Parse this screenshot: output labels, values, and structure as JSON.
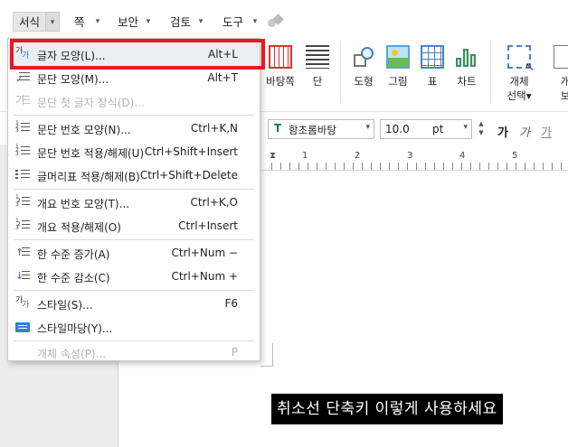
{
  "menubar": {
    "items": [
      {
        "label": "서식",
        "active": true
      },
      {
        "label": "쪽"
      },
      {
        "label": "보안"
      },
      {
        "label": "검토"
      },
      {
        "label": "도구"
      }
    ],
    "dropdown_arrow": "▾"
  },
  "ribbon": {
    "buttons": [
      {
        "label": "바탕쪽",
        "icon": "page-template-icon"
      },
      {
        "label": "단",
        "icon": "columns-icon"
      },
      {
        "label": "도형",
        "icon": "shapes-icon"
      },
      {
        "label": "그림",
        "icon": "picture-icon"
      },
      {
        "label": "표",
        "icon": "table-icon"
      },
      {
        "label": "차트",
        "icon": "chart-icon"
      },
      {
        "label": "개체",
        "sub": "선택",
        "icon": "object-select-icon"
      },
      {
        "label": "개",
        "sub": "보",
        "icon": "object-icon"
      }
    ]
  },
  "format_toolbar": {
    "font_name": "함초롬바탕",
    "font_size": "10.0",
    "size_unit": "pt",
    "style_buttons": [
      "가",
      "가",
      "가"
    ]
  },
  "ruler": {
    "numbers": [
      "1",
      "2",
      "3",
      "4",
      "5"
    ]
  },
  "dropdown": {
    "items": [
      {
        "label": "글자 모양(L)...",
        "shortcut": "Alt+L",
        "icon": "char-shape-icon",
        "disabled": false,
        "highlight": true
      },
      {
        "label": "문단 모양(M)...",
        "shortcut": "Alt+T",
        "icon": "paragraph-shape-icon",
        "disabled": false
      },
      {
        "label": "문단 첫 글자 장식(D)...",
        "shortcut": "",
        "icon": "drop-cap-icon",
        "disabled": true
      },
      {
        "label": "문단 번호 모양(N)...",
        "shortcut": "Ctrl+K,N",
        "icon": "numbering-shape-icon",
        "disabled": false,
        "sep_before": true
      },
      {
        "label": "문단 번호 적용/해제(U)",
        "shortcut": "Ctrl+Shift+Insert",
        "icon": "numbering-toggle-icon",
        "disabled": false
      },
      {
        "label": "글머리표 적용/해제(B)",
        "shortcut": "Ctrl+Shift+Delete",
        "icon": "bullet-toggle-icon",
        "disabled": false
      },
      {
        "label": "개요 번호 모양(T)...",
        "shortcut": "Ctrl+K,O",
        "icon": "outline-shape-icon",
        "disabled": false,
        "sep_before": true
      },
      {
        "label": "개요 적용/해제(O)",
        "shortcut": "Ctrl+Insert",
        "icon": "outline-toggle-icon",
        "disabled": false
      },
      {
        "label": "한 수준 증가(A)",
        "shortcut": "Ctrl+Num −",
        "icon": "level-increase-icon",
        "disabled": false,
        "sep_before": true
      },
      {
        "label": "한 수준 감소(C)",
        "shortcut": "Ctrl+Num +",
        "icon": "level-decrease-icon",
        "disabled": false
      },
      {
        "label": "스타일(S)...",
        "shortcut": "F6",
        "icon": "style-icon",
        "disabled": false,
        "sep_before": true
      },
      {
        "label": "스타일마당(Y)...",
        "shortcut": "",
        "icon": "style-gallery-icon",
        "disabled": false
      },
      {
        "label": "개체 속성(P)...",
        "shortcut": "P",
        "icon": "",
        "disabled": true,
        "sep_before": true
      }
    ]
  },
  "caption": {
    "text": "취소선 단축키 이렇게 사용하세요"
  },
  "colors": {
    "highlight_border": "#e8181e",
    "caption_bg": "#000000",
    "caption_fg": "#ffffff"
  }
}
